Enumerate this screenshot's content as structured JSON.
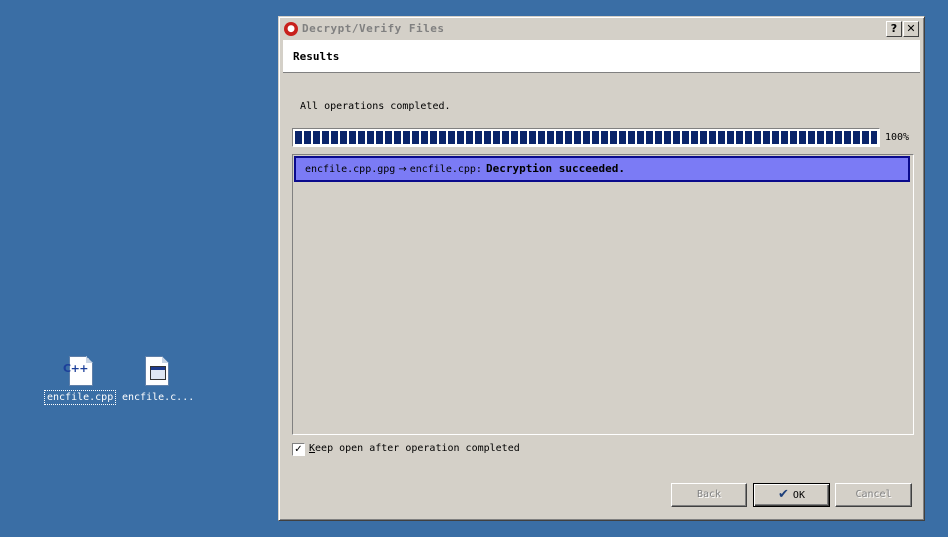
{
  "desktop": {
    "icons": [
      {
        "label": "encfile.cpp",
        "icon": "cpp-file-icon",
        "selected": true
      },
      {
        "label": "encfile.c...",
        "icon": "executable-file-icon",
        "selected": false
      }
    ]
  },
  "dialog": {
    "title": "Decrypt/Verify Files",
    "title_icon": "kleopatra-app-icon",
    "help_button": "?",
    "close_button": "✕",
    "page_title": "Results",
    "status_text": "All operations completed.",
    "progress": {
      "value": 1.0,
      "label": "100%"
    },
    "results": [
      {
        "input": "encfile.cpp.gpg",
        "arrow": "→",
        "output": "encfile.cpp:",
        "status": "Decryption succeeded."
      }
    ],
    "keep_open": {
      "label": "Keep open after operation completed",
      "checked": true,
      "mark": "✓"
    },
    "buttons": {
      "back": "Back",
      "ok": "OK",
      "cancel": "Cancel",
      "ok_icon": "✔"
    }
  },
  "colors": {
    "desktop_bg": "#3a6ea5",
    "window_bg": "#d4d0c8",
    "progress_fill": "#0a246a",
    "result_highlight": "#7b7bf5",
    "result_border": "#0a0a8c"
  }
}
